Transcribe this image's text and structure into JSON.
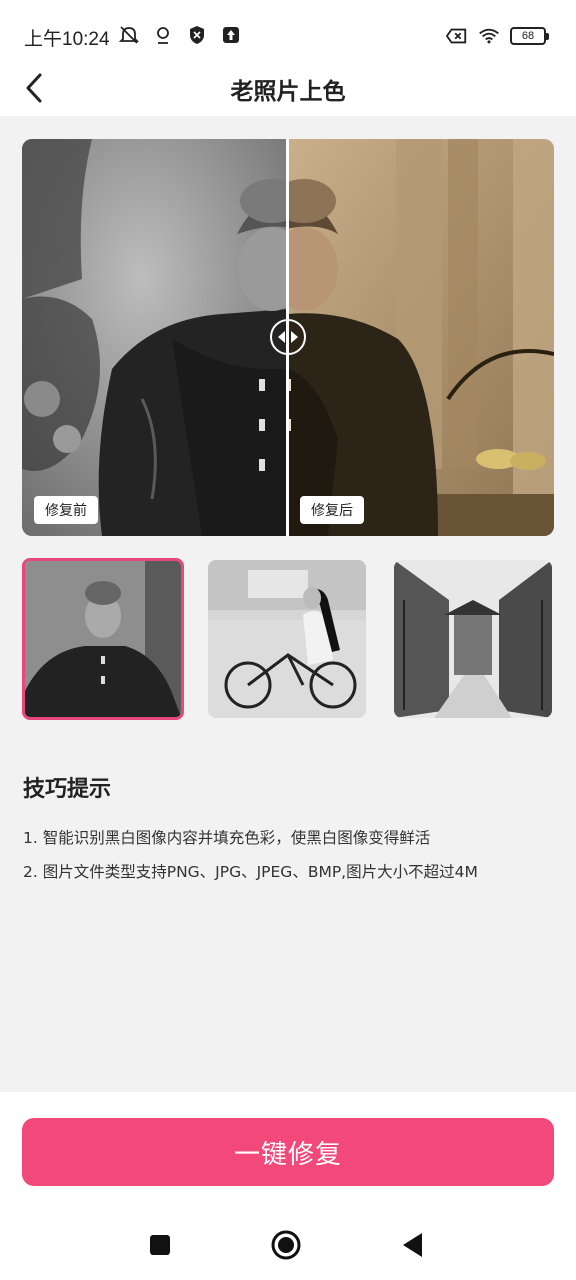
{
  "status_bar": {
    "time": "上午10:24",
    "battery": "68",
    "icons": [
      "mute-bell-icon",
      "location-icon",
      "shield-icon",
      "upload-icon",
      "sim-error-icon",
      "wifi-icon",
      "battery-icon"
    ]
  },
  "header": {
    "title": "老照片上色",
    "back_icon": "chevron-left-icon"
  },
  "compare": {
    "before_label": "修复前",
    "after_label": "修复后",
    "handle_icon": "compare-slider-icon"
  },
  "thumbnails": [
    {
      "name": "portrait-man",
      "selected": true
    },
    {
      "name": "woman-on-bicycle",
      "selected": false
    },
    {
      "name": "old-street",
      "selected": false
    }
  ],
  "tips": {
    "title": "技巧提示",
    "items": [
      "1. 智能识别黑白图像内容并填充色彩，使黑白图像变得鲜活",
      "2. 图片文件类型支持PNG、JPG、JPEG、BMP,图片大小不超过4M"
    ]
  },
  "action": {
    "label": "一键修复",
    "color": "#f2487a"
  },
  "nav": {
    "icons": [
      "recents-square-icon",
      "home-circle-icon",
      "back-triangle-icon"
    ]
  }
}
